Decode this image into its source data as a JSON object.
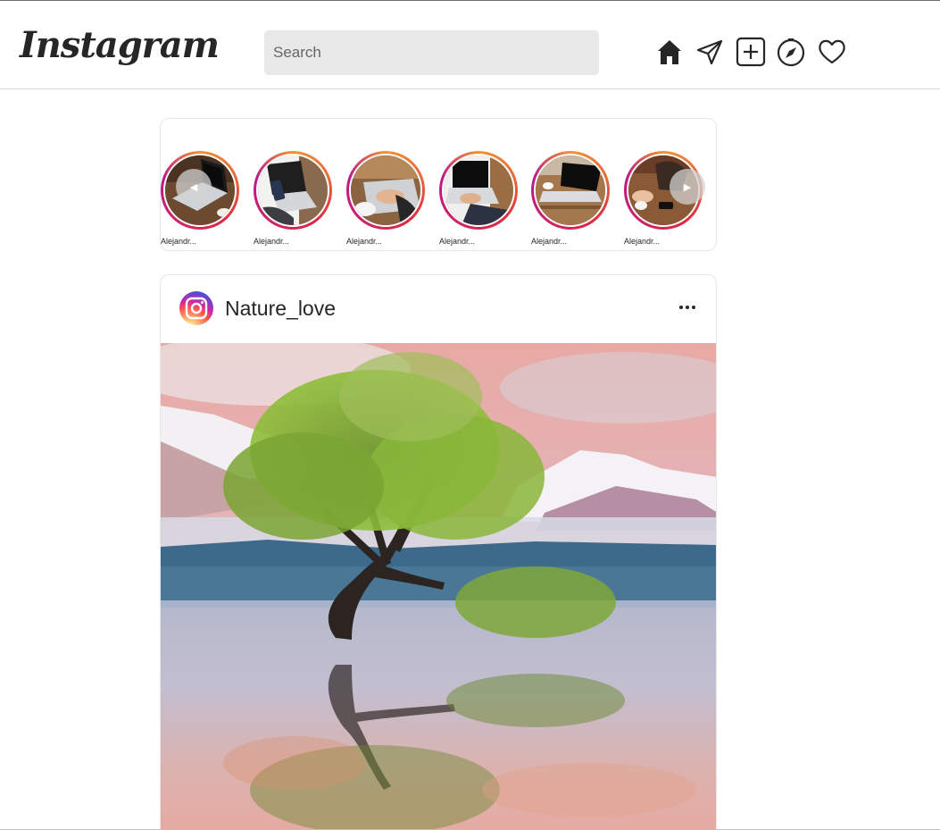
{
  "header": {
    "logo_text": "Instagram",
    "search_placeholder": "Search",
    "icons": [
      "home-icon",
      "send-icon",
      "new-post-icon",
      "explore-icon",
      "activity-heart-icon"
    ]
  },
  "stories": {
    "items": [
      {
        "name": "Alejandr..."
      },
      {
        "name": "Alejandr..."
      },
      {
        "name": "Alejandr..."
      },
      {
        "name": "Alejandr..."
      },
      {
        "name": "Alejandr..."
      },
      {
        "name": "Alejandr..."
      }
    ]
  },
  "post": {
    "username": "Nature_love"
  },
  "colors": {
    "ring_gradient": [
      "#f09433",
      "#dc2743",
      "#bc1888"
    ],
    "search_bg": "#e8e8e8",
    "icon": "#262626"
  }
}
